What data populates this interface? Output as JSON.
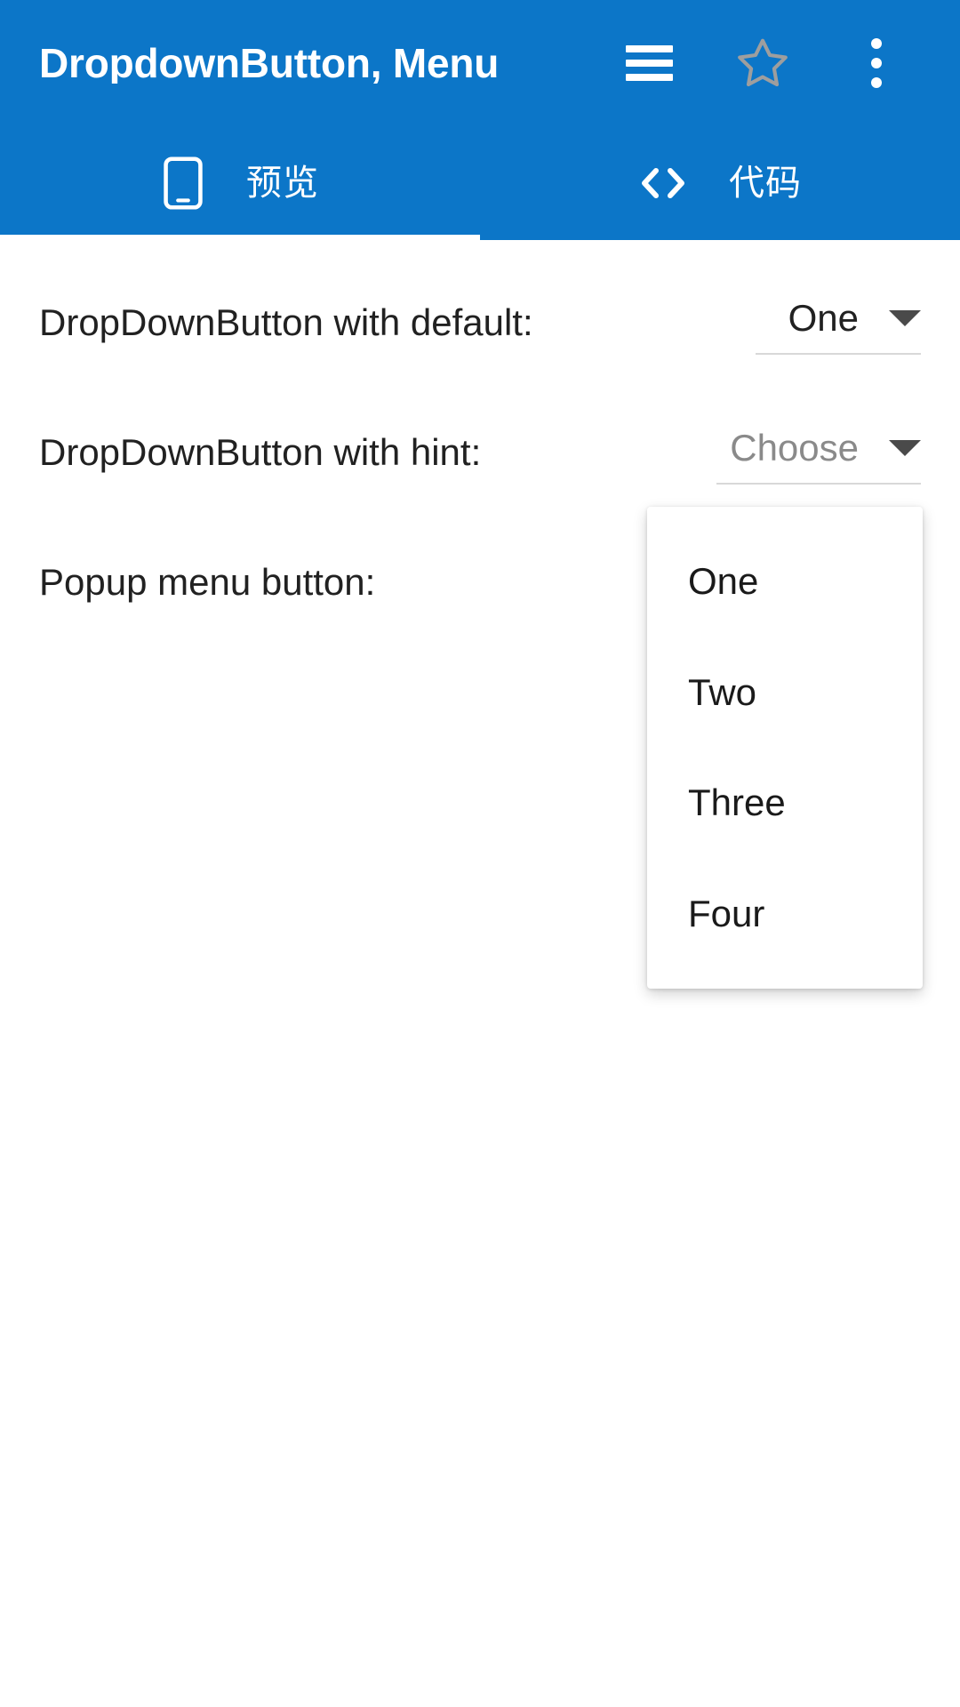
{
  "appbar": {
    "title": "DropdownButton, Menu",
    "actions": [
      {
        "name": "menu-icon",
        "label": "Menu"
      },
      {
        "name": "star-icon",
        "label": "Favorite"
      },
      {
        "name": "more-vert-icon",
        "label": "More options"
      }
    ],
    "background_color": "#0C76C8",
    "title_color": "#FFFFFF",
    "star_color": "#9E9E9E"
  },
  "tabs": [
    {
      "label": "预览",
      "icon": "phone-android-icon",
      "selected": true
    },
    {
      "label": "代码",
      "icon": "code-icon",
      "selected": false
    }
  ],
  "content": {
    "rows": [
      {
        "label": "DropDownButton with default:",
        "control": "dropdown",
        "value": "One",
        "is_hint": false
      },
      {
        "label": "DropDownButton with hint:",
        "control": "dropdown",
        "value": "Choose",
        "is_hint": true
      },
      {
        "label": "Popup menu button:",
        "control": "popup-menu"
      }
    ]
  },
  "popup_menu": {
    "visible": true,
    "items": [
      {
        "label": "One"
      },
      {
        "label": "Two"
      },
      {
        "label": "Three"
      },
      {
        "label": "Four"
      }
    ]
  },
  "colors": {
    "primary": "#0C76C8",
    "text": "#212121",
    "hint_text": "#8A8A8A",
    "underline": "#D8D8D8",
    "caret": "#4A4A4A",
    "surface": "#FFFFFF"
  }
}
